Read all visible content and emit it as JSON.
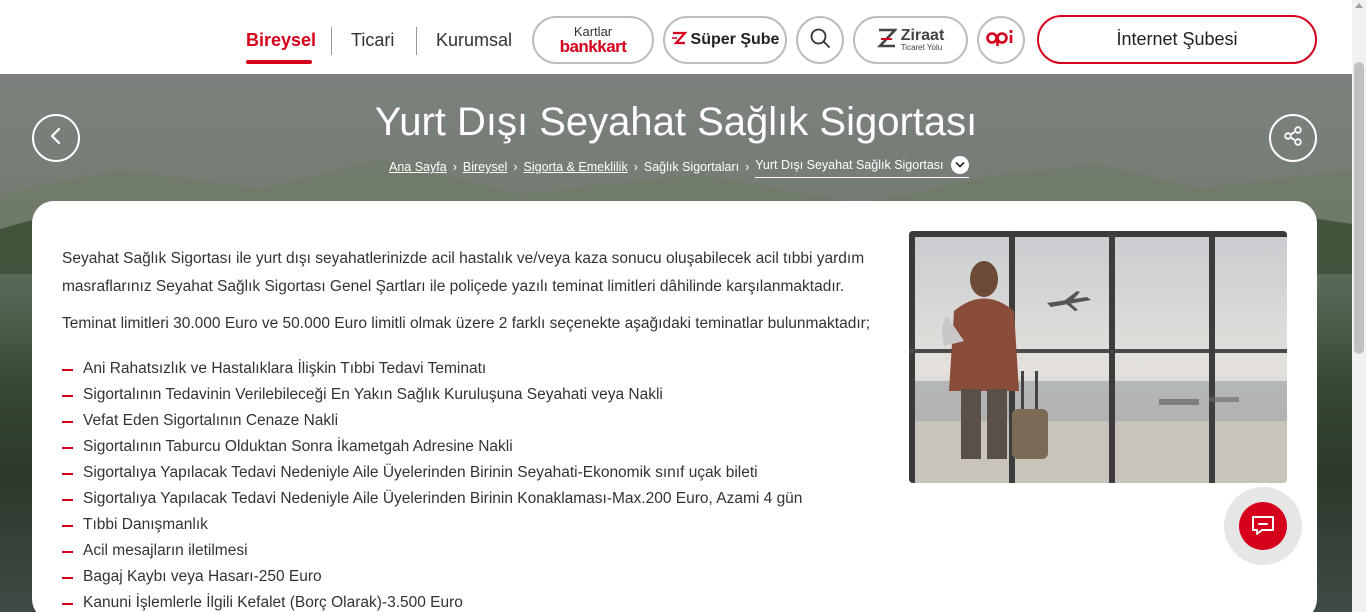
{
  "nav": {
    "bireysel": "Bireysel",
    "ticari": "Ticari",
    "kurumsal": "Kurumsal"
  },
  "header_buttons": {
    "kartlar_top": "Kartlar",
    "kartlar_brand": "bankkart",
    "super_sube": "Süper Şube",
    "ziraat_main": "Ziraat",
    "ziraat_sub": "Ticaret Yolu",
    "search_icon": "search-icon",
    "opi_label": "opi",
    "internet_subesi": "İnternet Şubesi"
  },
  "hero": {
    "title": "Yurt Dışı Seyahat Sağlık Sigortası",
    "breadcrumb": [
      "Ana Sayfa",
      "Bireysel",
      "Sigorta & Emeklilik",
      "Sağlık Sigortaları",
      "Yurt Dışı Seyahat Sağlık Sigortası"
    ]
  },
  "content": {
    "intro": "Seyahat Sağlık Sigortası ile yurt dışı seyahatlerinizde acil hastalık ve/veya kaza sonucu oluşabilecek acil tıbbi yardım masraflarınız Seyahat Sağlık Sigortası Genel Şartları ile poliçede yazılı teminat limitleri dâhilinde karşılanmaktadır.",
    "limits": "Teminat limitleri 30.000 Euro ve 50.000 Euro limitli olmak üzere 2 farklı seçenekte aşağıdaki teminatlar bulunmaktadır;",
    "items": [
      "Ani Rahatsızlık ve Hastalıklara İlişkin Tıbbi Tedavi Teminatı",
      "Sigortalının Tedavinin Verilebileceği En Yakın Sağlık Kuruluşuna Seyahati veya Nakli",
      "Vefat Eden Sigortalının Cenaze Nakli",
      "Sigortalının Taburcu Olduktan Sonra İkametgah Adresine Nakli",
      "Sigortalıya Yapılacak Tedavi Nedeniyle Aile Üyelerinden Birinin Seyahati-Ekonomik sınıf uçak bileti",
      "Sigortalıya Yapılacak Tedavi Nedeniyle Aile Üyelerinden Birinin Konaklaması-Max.200 Euro, Azami 4 gün",
      "Tıbbi Danışmanlık",
      "Acil mesajların iletilmesi",
      "Bagaj Kaybı veya Hasarı-250 Euro",
      "Kanuni İşlemlerle İlgili Kefalet (Borç Olarak)-3.500 Euro"
    ]
  },
  "colors": {
    "brand": "#d6001c",
    "text": "#333333"
  }
}
